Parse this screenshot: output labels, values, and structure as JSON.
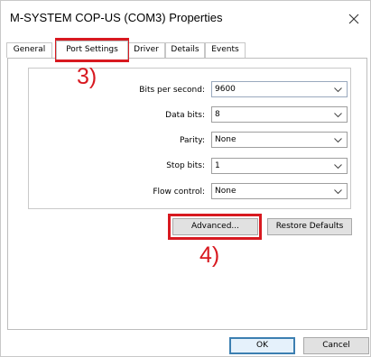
{
  "window": {
    "title": "M-SYSTEM COP-US (COM3) Properties"
  },
  "tabs": [
    {
      "label": "General",
      "selected": false
    },
    {
      "label": "Port Settings",
      "selected": true
    },
    {
      "label": "Driver",
      "selected": false
    },
    {
      "label": "Details",
      "selected": false
    },
    {
      "label": "Events",
      "selected": false
    }
  ],
  "settings": {
    "bits_per_second": {
      "label": "Bits per second:",
      "value": "9600"
    },
    "data_bits": {
      "label": "Data bits:",
      "value": "8"
    },
    "parity": {
      "label": "Parity:",
      "value": "None"
    },
    "stop_bits": {
      "label": "Stop bits:",
      "value": "1"
    },
    "flow_control": {
      "label": "Flow control:",
      "value": "None"
    }
  },
  "buttons": {
    "advanced": "Advanced...",
    "restore_defaults": "Restore Defaults",
    "ok": "OK",
    "cancel": "Cancel"
  },
  "annotations": {
    "step3": "3)",
    "step4": "4)",
    "color": "#d81920"
  }
}
